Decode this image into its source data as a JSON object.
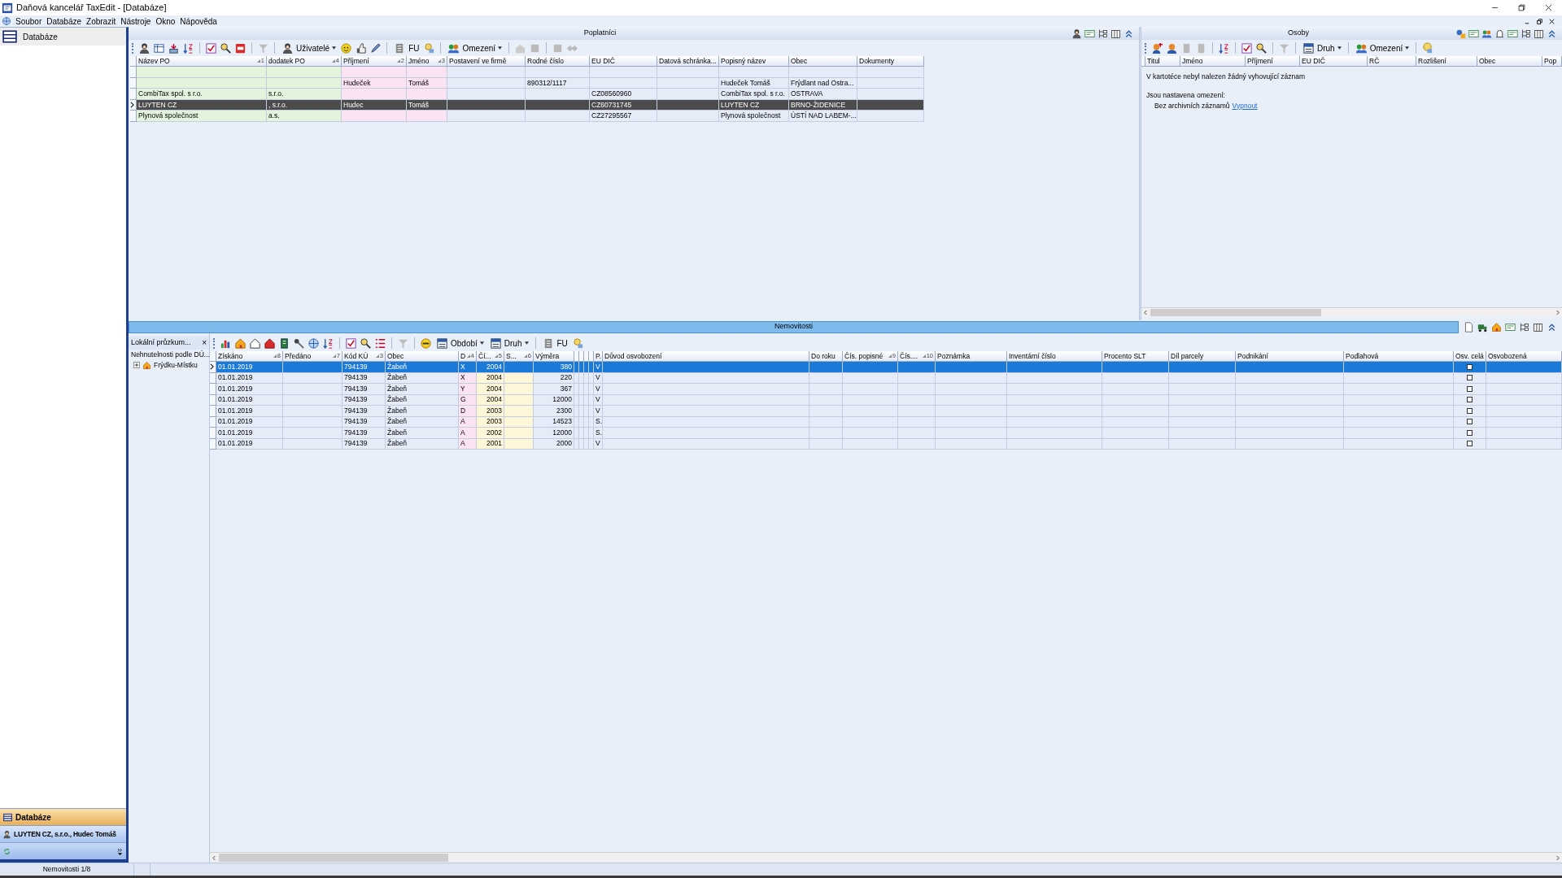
{
  "window": {
    "title": "Daňová kancelář TaxEdit - [Databáze]"
  },
  "menu": [
    "Soubor",
    "Databáze",
    "Zobrazit",
    "Nástroje",
    "Okno",
    "Nápověda"
  ],
  "sidebar": {
    "items": [
      {
        "label": "Databáze",
        "selected": true
      }
    ],
    "bands": [
      {
        "kind": "section",
        "label": "Databáze"
      },
      {
        "kind": "client",
        "label": "LUYTEN CZ, s.r.o., Hudec Tomáš"
      },
      {
        "kind": "tools"
      }
    ]
  },
  "poplatnici": {
    "title": "Poplatníci",
    "toolbar": [
      {
        "label": "Uživatelé",
        "dropdown": true
      },
      {
        "label": "FU",
        "dropdown": false
      },
      {
        "label": "Omezení",
        "dropdown": true
      }
    ],
    "columns": [
      {
        "label": "Název PO",
        "sort": "1"
      },
      {
        "label": "dodatek PO",
        "sort": "4"
      },
      {
        "label": "Příjmení",
        "sort": "2"
      },
      {
        "label": "Jméno",
        "sort": "3"
      },
      {
        "label": "Postavení ve firmě"
      },
      {
        "label": "Rodné číslo"
      },
      {
        "label": "EU DIČ"
      },
      {
        "label": "Datová schránka..."
      },
      {
        "label": "Popisný název"
      },
      {
        "label": "Obec"
      },
      {
        "label": "Dokumenty"
      }
    ],
    "rows": [
      {
        "selected": false,
        "cells": [
          null,
          null,
          null,
          null,
          null,
          null,
          null,
          null,
          null,
          null,
          null
        ]
      },
      {
        "selected": false,
        "cells": [
          null,
          null,
          "Hudeček",
          "Tomáš",
          null,
          "890312/1117",
          null,
          null,
          "Hudeček Tomáš",
          "Frýdlant nad Ostra...",
          null
        ]
      },
      {
        "selected": false,
        "cells": [
          "CombiTax spol. s r.o.",
          "s.r.o.",
          null,
          null,
          null,
          null,
          "CZ08560960",
          null,
          "CombiTax spol. s r.o.",
          "OSTRAVA",
          null
        ]
      },
      {
        "selected": true,
        "cells": [
          "LUYTEN CZ",
          ", s.r.o.",
          "Hudec",
          "Tomáš",
          null,
          null,
          "CZ60731745",
          null,
          "LUYTEN CZ",
          "BRNO-ŽIDENICE",
          null
        ]
      },
      {
        "selected": false,
        "cells": [
          "Plynová společnost",
          "a.s.",
          null,
          null,
          null,
          null,
          "CZ27295567",
          null,
          "Plynová společnost",
          "ÚSTÍ NAD LABEM-...",
          null
        ]
      }
    ]
  },
  "osoby": {
    "title": "Osoby",
    "toolbar": [
      {
        "label": "Druh",
        "dropdown": true
      },
      {
        "label": "Omezení",
        "dropdown": true
      }
    ],
    "columns": [
      {
        "label": "Titul"
      },
      {
        "label": "Jméno"
      },
      {
        "label": "Příjmení"
      },
      {
        "label": "EU DIČ"
      },
      {
        "label": "RČ"
      },
      {
        "label": "Rozlišení"
      },
      {
        "label": "Obec"
      },
      {
        "label": "Pop"
      }
    ],
    "message": "V kartotéce nebyl nalezen žádný vyhovující záznam",
    "restrictions_heading": "Jsou nastavena omezení:",
    "restriction": "Bez archivních záznamů",
    "restriction_link": "Vypnout"
  },
  "nemovitosti": {
    "title": "Nemovitosti",
    "explorer": {
      "title": "Lokální průzkum...",
      "close": "×",
      "group": "Nehnutelnosti podle DÚ...",
      "tree": [
        {
          "label": "Frýdku-Místku",
          "expanded": false
        }
      ]
    },
    "toolbar": [
      {
        "label": "Období",
        "dropdown": true
      },
      {
        "label": "Druh",
        "dropdown": true
      },
      {
        "label": "FU",
        "dropdown": false
      }
    ],
    "columns": [
      {
        "label": "Získáno",
        "sort": "8"
      },
      {
        "label": "Předáno",
        "sort": "7"
      },
      {
        "label": "Kód KÚ",
        "sort": "3"
      },
      {
        "label": "Obec"
      },
      {
        "label": "D",
        "sort": "4"
      },
      {
        "label": "Čí...",
        "sort": "5"
      },
      {
        "label": "S...",
        "sort": "6"
      },
      {
        "label": "Výměra"
      },
      {
        "label": "P."
      },
      {
        "label": "Důvod osvobození"
      },
      {
        "label": "Do roku"
      },
      {
        "label": "Čís. popisné",
        "sort": "9"
      },
      {
        "label": "Čís....",
        "sort": "10"
      },
      {
        "label": "Poznámka"
      },
      {
        "label": "Inventární číslo"
      },
      {
        "label": "Procento SLT"
      },
      {
        "label": "Díl parcely"
      },
      {
        "label": "Podnikání"
      },
      {
        "label": "Podlahová"
      },
      {
        "label": "Osv. celá"
      },
      {
        "label": "Osvobozená"
      }
    ],
    "rows": [
      {
        "selected": true,
        "osv_cela_checked": false,
        "cells": [
          "01.01.2019",
          null,
          "794139",
          "Žabeň",
          "X",
          "2004",
          null,
          "380",
          "V"
        ]
      },
      {
        "selected": false,
        "osv_cela_checked": false,
        "cells": [
          "01.01.2019",
          null,
          "794139",
          "Žabeň",
          "X",
          "2004",
          null,
          "220",
          "V"
        ]
      },
      {
        "selected": false,
        "osv_cela_checked": false,
        "cells": [
          "01.01.2019",
          null,
          "794139",
          "Žabeň",
          "Y",
          "2004",
          null,
          "367",
          "V"
        ]
      },
      {
        "selected": false,
        "osv_cela_checked": false,
        "cells": [
          "01.01.2019",
          null,
          "794139",
          "Žabeň",
          "G",
          "2004",
          null,
          "12000",
          "V"
        ]
      },
      {
        "selected": false,
        "osv_cela_checked": false,
        "cells": [
          "01.01.2019",
          null,
          "794139",
          "Žabeň",
          "D",
          "2003",
          null,
          "2300",
          "V"
        ]
      },
      {
        "selected": false,
        "osv_cela_checked": false,
        "cells": [
          "01.01.2019",
          null,
          "794139",
          "Žabeň",
          "A",
          "2003",
          null,
          "14523",
          "S."
        ]
      },
      {
        "selected": false,
        "osv_cela_checked": false,
        "cells": [
          "01.01.2019",
          null,
          "794139",
          "Žabeň",
          "A",
          "2002",
          null,
          "12000",
          "S."
        ]
      },
      {
        "selected": false,
        "osv_cela_checked": false,
        "cells": [
          "01.01.2019",
          null,
          "794139",
          "Žabeň",
          "A",
          "2001",
          null,
          "2000",
          "V"
        ]
      }
    ]
  },
  "status_bar": {
    "text": "Nemovitosti 1/8"
  }
}
